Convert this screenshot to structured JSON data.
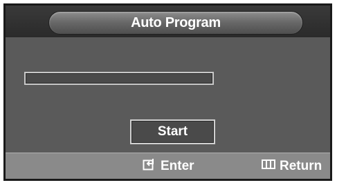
{
  "screen": {
    "title": "Auto Program"
  },
  "progress": {
    "value": 0
  },
  "start_button": {
    "label": "Start"
  },
  "footer": {
    "enter": {
      "icon": "enter-icon",
      "label": "Enter"
    },
    "return": {
      "icon": "return-icon",
      "label": "Return"
    }
  }
}
